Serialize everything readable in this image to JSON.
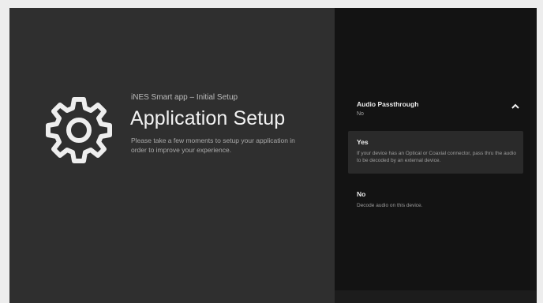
{
  "setup": {
    "subtitle": "iNES Smart app – Initial Setup",
    "title": "Application Setup",
    "description": "Please take a few moments to setup your application in order to improve your experience."
  },
  "setting": {
    "title": "Audio Passthrough",
    "value": "No",
    "options": [
      {
        "label": "Yes",
        "description": "If your device has an Optical or Coaxial connector, pass thru the audio to be decoded by an external device."
      },
      {
        "label": "No",
        "description": "Decode audio on this device."
      }
    ]
  },
  "icons": {
    "gear": "gear-icon",
    "chevron": "chevron-up-icon"
  },
  "colors": {
    "left_panel": "#2f2f2f",
    "right_panel": "#131313",
    "selected_option": "#2a2a2a",
    "text_primary": "#f2f2f2"
  }
}
